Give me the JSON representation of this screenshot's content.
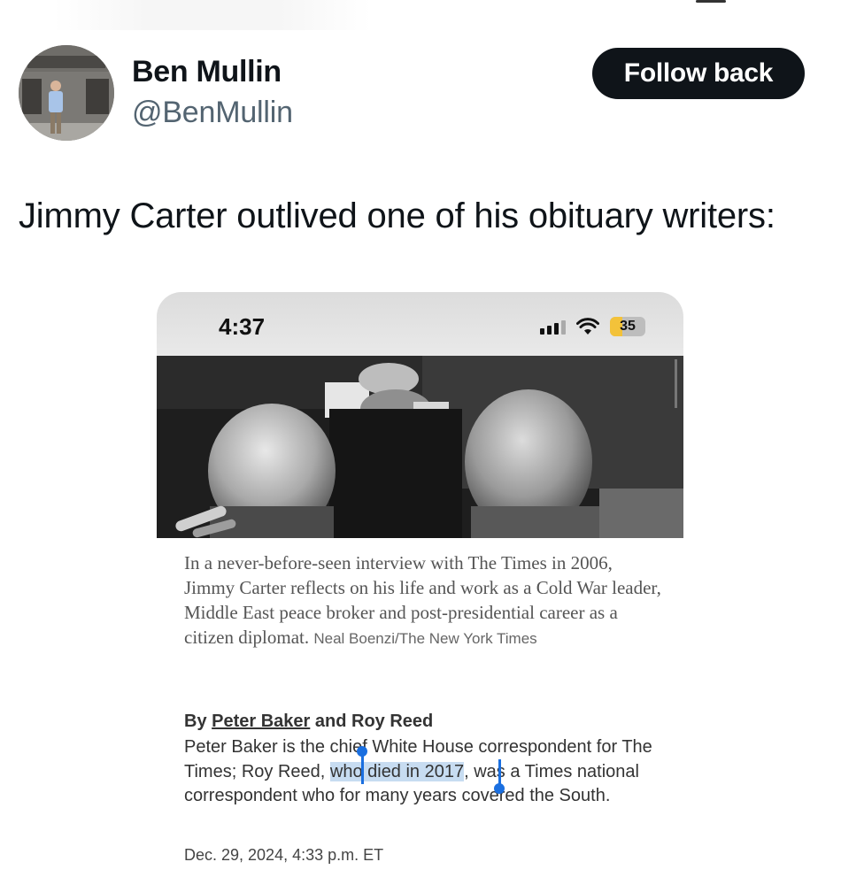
{
  "tweet": {
    "author_name": "Ben Mullin",
    "author_handle": "@BenMullin",
    "follow_button": "Follow back",
    "text": "Jimmy Carter outlived one of his obituary writers:"
  },
  "embedded": {
    "status_time": "4:37",
    "battery_level": "35",
    "battery_fraction": 0.35,
    "caption_text": "In a never-before-seen interview with The Times in 2006, Jimmy Carter reflects on his life and work as a Cold War leader, Middle East peace broker and post-presidential career as a citizen diplomat.",
    "caption_credit": "Neal Boenzi/The New York Times",
    "byline_prefix": "By",
    "author_1": "Peter Baker",
    "byline_and": "and Roy Reed",
    "bio_before": "Peter Baker is the chief White House correspondent for The Times; Roy Reed, ",
    "bio_highlight": "who died in 2017",
    "bio_after": ", was a Times national correspondent who for many years covered the South.",
    "date": "Dec. 29, 2024, 4:33 p.m. ET"
  },
  "icons": [
    "cellular-signal-icon",
    "wifi-icon",
    "battery-icon"
  ]
}
